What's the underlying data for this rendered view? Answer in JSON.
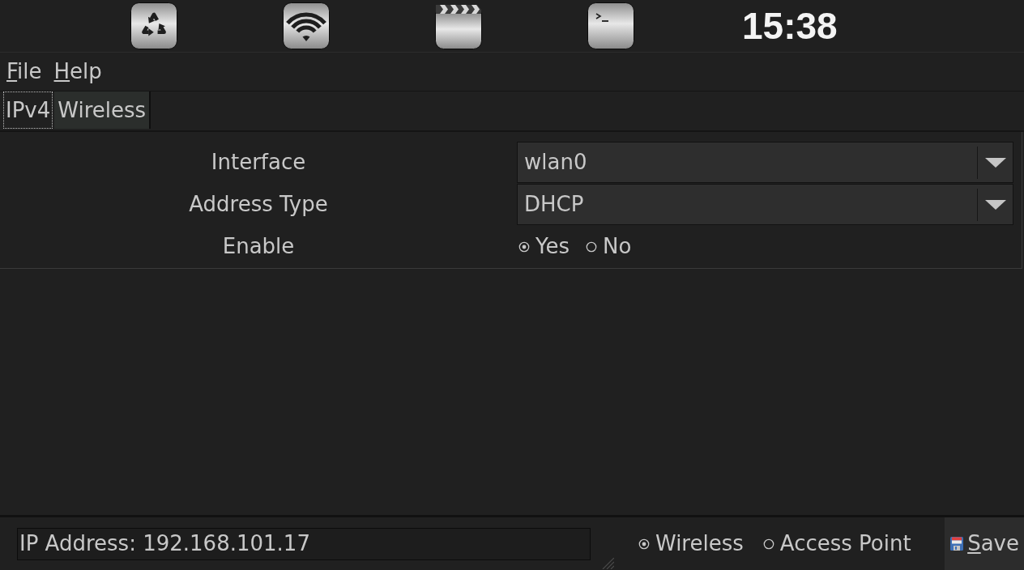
{
  "top_bar": {
    "launchers": [
      {
        "kind": "recycle"
      },
      {
        "kind": "wifi"
      },
      {
        "kind": "clapperboard"
      },
      {
        "kind": "terminal"
      }
    ],
    "clock": "15:38"
  },
  "menu_bar": [
    {
      "label": "File",
      "mnemonic_underlined": true
    },
    {
      "label": "Help",
      "mnemonic_underlined": true
    }
  ],
  "tabs": [
    {
      "label": "IPv4",
      "selected": true
    },
    {
      "label": "Wireless",
      "selected": false
    }
  ],
  "form": {
    "rows": [
      {
        "kind": "dropdown",
        "label": "Interface",
        "value": "wlan0"
      },
      {
        "kind": "dropdown",
        "label": "Address Type",
        "value": "DHCP"
      },
      {
        "kind": "radio",
        "label": "Enable",
        "options": [
          {
            "label": "Yes",
            "selected": true
          },
          {
            "label": "No",
            "selected": false
          }
        ]
      }
    ]
  },
  "status_bar": {
    "ip_field": {
      "value": "IP Address: 192.168.101.17"
    },
    "mode_options": [
      {
        "label": "Wireless",
        "selected": true
      },
      {
        "label": "Access Point",
        "selected": false
      }
    ],
    "save_button": {
      "label": "Save",
      "mnemonic_underlined": true
    }
  }
}
